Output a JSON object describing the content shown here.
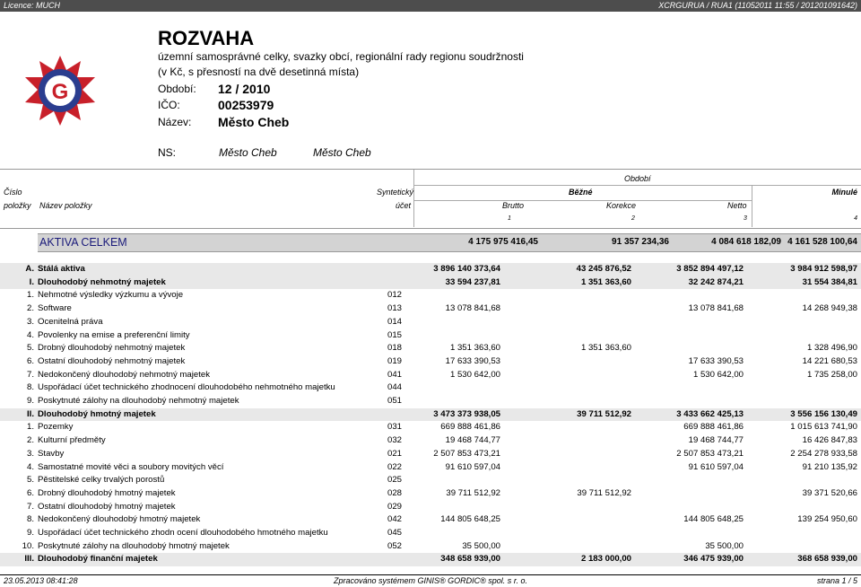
{
  "header": {
    "licence": "Licence: MUCH",
    "system_id": "XCRGURUA / RUA1  (11052011 11:55 / 201201091642)"
  },
  "report": {
    "title": "ROZVAHA",
    "subtitle1": "územní samosprávné celky, svazky obcí, regionální rady regionu soudržnosti",
    "subtitle2": "(v Kč, s přesností na dvě desetinná místa)",
    "obdobi_label": "Období:",
    "obdobi_value": "12 / 2010",
    "ico_label": "IČO:",
    "ico_value": "00253979",
    "nazev_label": "Název:",
    "nazev_value": "Město Cheb",
    "ns_label": "NS:",
    "ns_value1": "Město Cheb",
    "ns_value2": "Město Cheb"
  },
  "colors": {
    "header_bar": "#4d4d4d",
    "logo_red": "#c8202a",
    "logo_blue": "#2a3d8f",
    "total_bar": "#d3d3d3"
  },
  "columns": {
    "cislo": "Číslo",
    "polozky": "položky",
    "nazev": "Název položky",
    "syntheticky": "Syntetický",
    "ucet": "účet",
    "obdobi": "Období",
    "bezne": "Běžné",
    "minule": "Minulé",
    "brutto": "Brutto",
    "korekce": "Korekce",
    "netto": "Netto",
    "n1": "1",
    "n2": "2",
    "n3": "3",
    "n4": "4"
  },
  "total": {
    "label": "AKTIVA CELKEM",
    "brutto": "4 175 975 416,45",
    "korekce": "91 357 234,36",
    "netto": "4 084 618 182,09",
    "minule": "4 161 528 100,64"
  },
  "rows": [
    {
      "mark": "A.",
      "name": "Stálá aktiva",
      "ucet": "",
      "brutto": "3 896 140 373,64",
      "korekce": "43 245 876,52",
      "netto": "3 852 894 497,12",
      "minule": "3 984 912 598,97"
    },
    {
      "mark": "I.",
      "name": "Dlouhodobý nehmotný majetek",
      "ucet": "",
      "brutto": "33 594 237,81",
      "korekce": "1 351 363,60",
      "netto": "32 242 874,21",
      "minule": "31 554 384,81"
    },
    {
      "mark": "1.",
      "name": "Nehmotné výsledky výzkumu a vývoje",
      "ucet": "012",
      "brutto": "",
      "korekce": "",
      "netto": "",
      "minule": ""
    },
    {
      "mark": "2.",
      "name": "Software",
      "ucet": "013",
      "brutto": "13 078 841,68",
      "korekce": "",
      "netto": "13 078 841,68",
      "minule": "14 268 949,38"
    },
    {
      "mark": "3.",
      "name": "Ocenitelná práva",
      "ucet": "014",
      "brutto": "",
      "korekce": "",
      "netto": "",
      "minule": ""
    },
    {
      "mark": "4.",
      "name": "Povolenky na emise a preferenční limity",
      "ucet": "015",
      "brutto": "",
      "korekce": "",
      "netto": "",
      "minule": ""
    },
    {
      "mark": "5.",
      "name": "Drobný dlouhodobý nehmotný majetek",
      "ucet": "018",
      "brutto": "1 351 363,60",
      "korekce": "1 351 363,60",
      "netto": "",
      "minule": "1 328 496,90"
    },
    {
      "mark": "6.",
      "name": "Ostatní dlouhodobý nehmotný majetek",
      "ucet": "019",
      "brutto": "17 633 390,53",
      "korekce": "",
      "netto": "17 633 390,53",
      "minule": "14 221 680,53"
    },
    {
      "mark": "7.",
      "name": "Nedokončený dlouhodobý nehmotný majetek",
      "ucet": "041",
      "brutto": "1 530 642,00",
      "korekce": "",
      "netto": "1 530 642,00",
      "minule": "1 735 258,00"
    },
    {
      "mark": "8.",
      "name": "Uspořádací účet technického zhodnocení dlouhodobého nehmotného majetku",
      "ucet": "044",
      "brutto": "",
      "korekce": "",
      "netto": "",
      "minule": ""
    },
    {
      "mark": "9.",
      "name": "Poskytnuté zálohy na dlouhodobý nehmotný majetek",
      "ucet": "051",
      "brutto": "",
      "korekce": "",
      "netto": "",
      "minule": ""
    },
    {
      "mark": "II.",
      "name": "Dlouhodobý hmotný majetek",
      "ucet": "",
      "brutto": "3 473 373 938,05",
      "korekce": "39 711 512,92",
      "netto": "3 433 662 425,13",
      "minule": "3 556 156 130,49"
    },
    {
      "mark": "1.",
      "name": "Pozemky",
      "ucet": "031",
      "brutto": "669 888 461,86",
      "korekce": "",
      "netto": "669 888 461,86",
      "minule": "1 015 613 741,90"
    },
    {
      "mark": "2.",
      "name": "Kulturní předměty",
      "ucet": "032",
      "brutto": "19 468 744,77",
      "korekce": "",
      "netto": "19 468 744,77",
      "minule": "16 426 847,83"
    },
    {
      "mark": "3.",
      "name": "Stavby",
      "ucet": "021",
      "brutto": "2 507 853 473,21",
      "korekce": "",
      "netto": "2 507 853 473,21",
      "minule": "2 254 278 933,58"
    },
    {
      "mark": "4.",
      "name": "Samostatné movité věci a soubory movitých věcí",
      "ucet": "022",
      "brutto": "91 610 597,04",
      "korekce": "",
      "netto": "91 610 597,04",
      "minule": "91 210 135,92"
    },
    {
      "mark": "5.",
      "name": "Pěstitelské celky trvalých porostů",
      "ucet": "025",
      "brutto": "",
      "korekce": "",
      "netto": "",
      "minule": ""
    },
    {
      "mark": "6.",
      "name": "Drobný dlouhodobý hmotný majetek",
      "ucet": "028",
      "brutto": "39 711 512,92",
      "korekce": "39 711 512,92",
      "netto": "",
      "minule": "39 371 520,66"
    },
    {
      "mark": "7.",
      "name": "Ostatní dlouhodobý hmotný majetek",
      "ucet": "029",
      "brutto": "",
      "korekce": "",
      "netto": "",
      "minule": ""
    },
    {
      "mark": "8.",
      "name": "Nedokončený dlouhodobý hmotný majetek",
      "ucet": "042",
      "brutto": "144 805 648,25",
      "korekce": "",
      "netto": "144 805 648,25",
      "minule": "139 254 950,60"
    },
    {
      "mark": "9.",
      "name": "Uspořádací účet technického zhodn ocení dlouhodobého hmotného majetku",
      "ucet": "045",
      "brutto": "",
      "korekce": "",
      "netto": "",
      "minule": ""
    },
    {
      "mark": "10.",
      "name": "Poskytnuté zálohy na dlouhodobý hmotný majetek",
      "ucet": "052",
      "brutto": "35 500,00",
      "korekce": "",
      "netto": "35 500,00",
      "minule": ""
    },
    {
      "mark": "III.",
      "name": "Dlouhodobý finanční majetek",
      "ucet": "",
      "brutto": "348 658 939,00",
      "korekce": "2 183 000,00",
      "netto": "346 475 939,00",
      "minule": "368 658 939,00"
    }
  ],
  "footer": {
    "date": "23.05.2013 08:41:28",
    "processed": "Zpracováno systémem  GINIS® GORDIC® spol. s  r. o.",
    "page": "strana 1 / 5"
  }
}
